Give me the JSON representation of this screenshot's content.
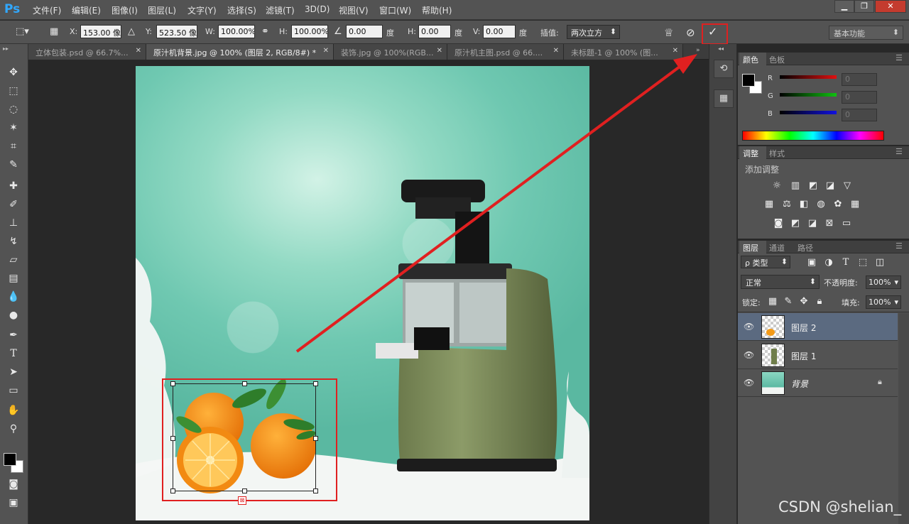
{
  "app": {
    "logo": "Ps"
  },
  "menu": [
    "文件(F)",
    "编辑(E)",
    "图像(I)",
    "图层(L)",
    "文字(Y)",
    "选择(S)",
    "滤镜(T)",
    "3D(D)",
    "视图(V)",
    "窗口(W)",
    "帮助(H)"
  ],
  "window_buttons": {
    "minimize": "▁",
    "restore": "❐",
    "close": "✕"
  },
  "options": {
    "x_label": "X:",
    "x_value": "153.00 像",
    "y_label": "Y:",
    "y_value": "523.50 像",
    "w_label": "W:",
    "w_value": "100.00%",
    "h_label": "H:",
    "h_value": "100.00%",
    "angle_value": "0.00",
    "angle_unit": "度",
    "hskew_label": "H:",
    "hskew_value": "0.00",
    "hskew_unit": "度",
    "vskew_label": "V:",
    "vskew_value": "0.00",
    "vskew_unit": "度",
    "interp_label": "插值:",
    "interp_value": "两次立方",
    "workspace": "基本功能"
  },
  "tabs": [
    {
      "label": "立体包装.psd @ 66.7%..."
    },
    {
      "label": "原汁机背景.jpg @ 100% (图层 2, RGB/8#) *"
    },
    {
      "label": "装饰.jpg @ 100%(RGB..."
    },
    {
      "label": "原汁机主图.psd @ 66...."
    },
    {
      "label": "未标题-1 @ 100% (图..."
    }
  ],
  "color_panel": {
    "tabs": [
      "颜色",
      "色板"
    ],
    "channels": [
      {
        "label": "R",
        "value": "0",
        "color": "#e01010"
      },
      {
        "label": "G",
        "value": "0",
        "color": "#10c010"
      },
      {
        "label": "B",
        "value": "0",
        "color": "#1010e0"
      }
    ]
  },
  "adjust_panel": {
    "tabs": [
      "调整",
      "样式"
    ],
    "title": "添加调整"
  },
  "layers_panel": {
    "tabs": [
      "图层",
      "通道",
      "路径"
    ],
    "filter_label": "ρ 类型",
    "blend_mode": "正常",
    "opacity_label": "不透明度:",
    "opacity_value": "100%",
    "lock_label": "锁定:",
    "fill_label": "填充:",
    "fill_value": "100%",
    "layers": [
      {
        "name": "图层 2",
        "selected": true
      },
      {
        "name": "图层 1",
        "selected": false
      },
      {
        "name": "背景",
        "selected": false,
        "locked": true
      }
    ]
  },
  "watermark": "CSDN @shelian_",
  "colors": {
    "accent_red": "#e02020",
    "selected_layer": "#5b6a80"
  }
}
